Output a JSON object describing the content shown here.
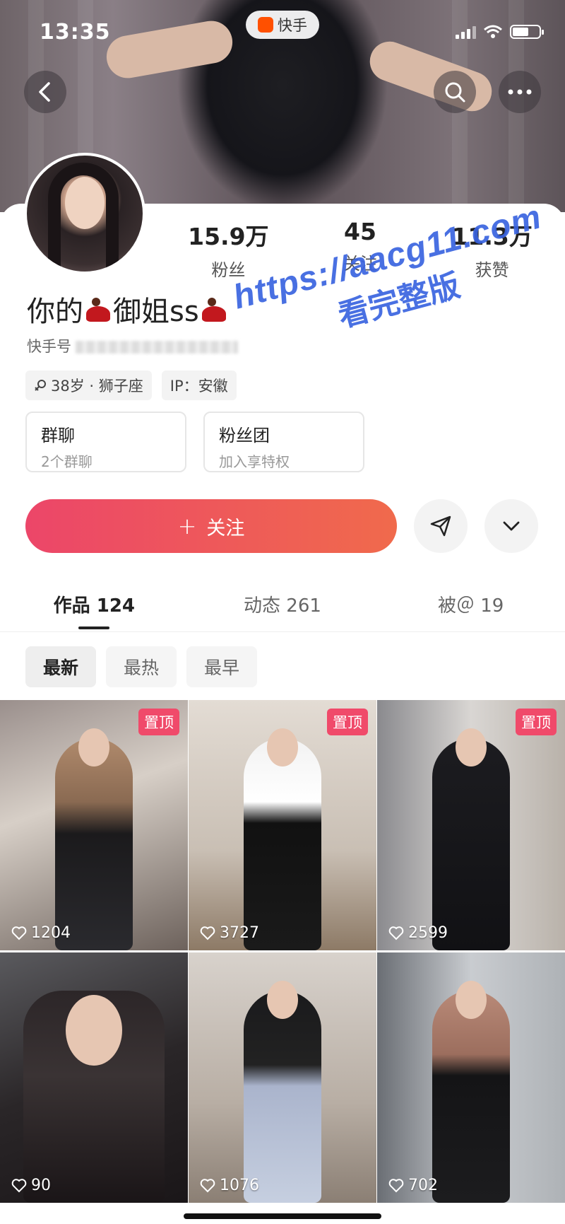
{
  "status_bar": {
    "time": "13:35",
    "app_pill": "快手"
  },
  "profile": {
    "stats": [
      {
        "value": "15.9万",
        "label": "粉丝"
      },
      {
        "value": "45",
        "label": "关注"
      },
      {
        "value": "11.3万",
        "label": "获赞"
      }
    ],
    "name_part1": "你的",
    "name_part2": "御姐ss",
    "kuaishou_id_label": "快手号",
    "tags": [
      {
        "text": "38岁 · 狮子座"
      },
      {
        "text": "IP：安徽"
      }
    ],
    "group_chat": {
      "title": "群聊",
      "subtitle": "2个群聊"
    },
    "fan_club": {
      "title": "粉丝团",
      "subtitle": "加入享特权"
    },
    "follow_label": "关注",
    "follow_plus": "+"
  },
  "tabs": [
    {
      "label": "作品 124"
    },
    {
      "label": "动态 261"
    },
    {
      "label": "被＠ 19"
    }
  ],
  "sorts": [
    {
      "label": "最新"
    },
    {
      "label": "最热"
    },
    {
      "label": "最早"
    }
  ],
  "videos": [
    {
      "likes": "1204",
      "pinned": "置顶"
    },
    {
      "likes": "3727",
      "pinned": "置顶"
    },
    {
      "likes": "2599",
      "pinned": "置顶"
    },
    {
      "likes": "90"
    },
    {
      "likes": "1076"
    },
    {
      "likes": "702"
    }
  ],
  "watermark": {
    "url": "https://aacg11.com",
    "cta": "看完整版"
  },
  "icons": {
    "back": "chevron-left-icon",
    "search": "search-icon",
    "more": "more-dots-icon",
    "share": "send-icon",
    "expand": "chevron-down-icon",
    "heart": "heart-icon"
  },
  "colors": {
    "follow_start": "#ec4669",
    "follow_end": "#f06a4c",
    "pin": "#f04a6a",
    "watermark": "#3a64e0"
  }
}
